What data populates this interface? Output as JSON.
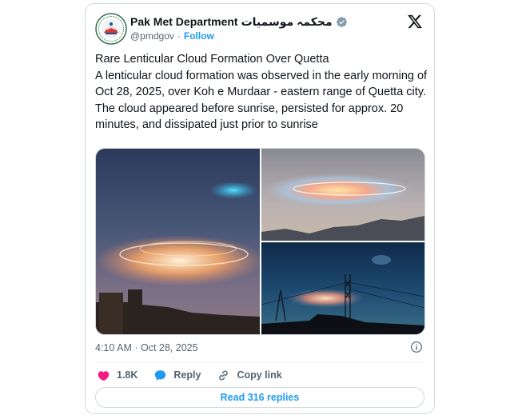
{
  "account": {
    "display_name": "Pak Met Department",
    "urdu_name": "محکمہ موسمیات",
    "handle": "@pmdgov",
    "separator": "·",
    "follow_label": "Follow",
    "verified_color": "#829aab"
  },
  "tweet": {
    "text": "Rare Lenticular Cloud Formation Over Quetta\nA lenticular cloud formation was observed in the early morning of Oct 28, 2025, over Koh e Murdaar - eastern range of Quetta city. The cloud appeared before sunrise, persisted for approx. 20 minutes, and dissipated just prior to sunrise",
    "timestamp": "4:10 AM · Oct 28, 2025"
  },
  "media": [
    {
      "icon": "photo-cloud-rooftop"
    },
    {
      "icon": "photo-cloud-mountains"
    },
    {
      "icon": "photo-cloud-tower"
    }
  ],
  "actions": {
    "like_count": "1.8K",
    "reply_label": "Reply",
    "copy_link_label": "Copy link",
    "read_replies_label": "Read 316 replies"
  },
  "colors": {
    "accent": "#1d9bf0",
    "like": "#f91880",
    "text_secondary": "#536471",
    "border": "#cfd9de"
  }
}
